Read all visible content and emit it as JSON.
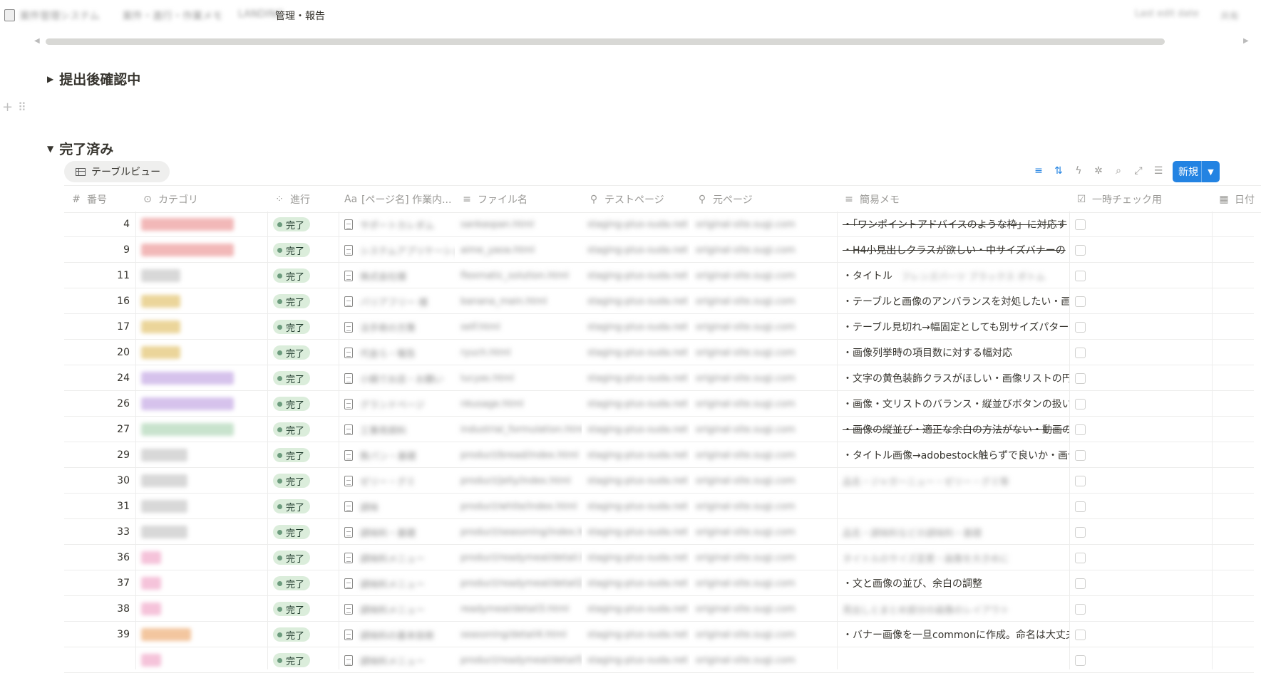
{
  "breadcrumb": {
    "blurred1": "案件管理システム",
    "blurred2": "案件・進行・作業メモ",
    "blurred3": "LANDING",
    "current": "管理・報告",
    "right1": "Last edit date",
    "right2": "共有"
  },
  "groups": {
    "submitted": {
      "title": "提出後確認中"
    },
    "done": {
      "title": "完了済み"
    }
  },
  "view": {
    "tab_label": "テーブルビュー"
  },
  "toolbar": {
    "new_label": "新規"
  },
  "columns": {
    "number": "番号",
    "category": "カテゴリ",
    "progress": "進行",
    "page_name": "[ページ名] 作業内...",
    "file_name": "ファイル名",
    "test_page": "テストページ",
    "original_page": "元ページ",
    "memo": "簡易メモ",
    "temp_check": "一時チェック用",
    "date": "日付"
  },
  "status_label": "完了",
  "colors": {
    "accent": "#2383e2",
    "status_bg": "#dbeddb",
    "status_dot": "#6c9b7d"
  },
  "rows": [
    {
      "num": "4",
      "cat_color": "#f2b8b8",
      "cat_w": 130,
      "page": "サポートカレダム",
      "file": "sankaspan.html",
      "test": "staging-plus-suda.net",
      "orig": "original-site.sugi.com",
      "memo": "・「ワンポイントアドバイスのような枠」に対応す",
      "memo_style": "strike"
    },
    {
      "num": "9",
      "cat_color": "#f2b8b8",
      "cat_w": 130,
      "page": "システムアプリケーション",
      "file": "aime_yaoa.html",
      "test": "staging-plus-suda.net",
      "orig": "original-site.sugi.com",
      "memo": "・H4小見出しクラスが欲しい・中サイズバナーの",
      "memo_style": "strike"
    },
    {
      "num": "11",
      "cat_color": "#d8d8d8",
      "cat_w": 55,
      "page": "株式会社様",
      "file": "flexmatic_solution.html",
      "test": "staging-plus-suda.net",
      "orig": "original-site.sugi.com",
      "memo": "・タイトル",
      "memo_style": "plain",
      "memo_extra": "フレンズパーツ ブラックス ボトム"
    },
    {
      "num": "16",
      "cat_color": "#ebd59a",
      "cat_w": 55,
      "page": "バリアフリー 様",
      "file": "banana_main.html",
      "test": "staging-plus-suda.net",
      "orig": "original-site.sugi.com",
      "memo": "・テーブルと画像のアンバランスを対処したい・画",
      "memo_style": "plain"
    },
    {
      "num": "17",
      "cat_color": "#ebd59a",
      "cat_w": 55,
      "page": "法手術の方策",
      "file": "self.html",
      "test": "staging-plus-suda.net",
      "orig": "original-site.sugi.com",
      "memo": "・テーブル見切れ→幅固定としても別サイズパター",
      "memo_style": "plain"
    },
    {
      "num": "20",
      "cat_color": "#ebd59a",
      "cat_w": 55,
      "page": "代金ら・報告",
      "file": "ryuch.html",
      "test": "staging-plus-suda.net",
      "orig": "original-site.sugi.com",
      "memo": "・画像列挙時の項目数に対する幅対応",
      "memo_style": "plain"
    },
    {
      "num": "24",
      "cat_color": "#d6c2ec",
      "cat_w": 130,
      "page": "小鍋でお店・お願い",
      "file": "lucyas.html",
      "test": "staging-plus-suda.net",
      "orig": "original-site.sugi.com",
      "memo": "・文字の黄色装飾クラスがほしい・画像リストの円",
      "memo_style": "plain"
    },
    {
      "num": "26",
      "cat_color": "#d6c2ec",
      "cat_w": 130,
      "page": "グランドページ",
      "file": "nkusage.html",
      "test": "staging-plus-suda.net",
      "orig": "original-site.sugi.com",
      "memo": "・画像・文リストのバランス・縦並びボタンの扱い",
      "memo_style": "plain"
    },
    {
      "num": "27",
      "cat_color": "#c8e3cd",
      "cat_w": 130,
      "page": "工事用資料",
      "file": "industrial_formulation.html",
      "test": "staging-plus-suda.net",
      "orig": "original-site.sugi.com",
      "memo": "・画像の縦並び・適正な余白の方法がない・動画の",
      "memo_style": "strike"
    },
    {
      "num": "29",
      "cat_color": "#d8d8d8",
      "cat_w": 65,
      "page": "数パン・基礎",
      "file": "product/bread/index.html",
      "test": "staging-plus-suda.net",
      "orig": "original-site.sugi.com",
      "memo": "・タイトル画像→adobestock触らずで良いか・画像",
      "memo_style": "plain"
    },
    {
      "num": "30",
      "cat_color": "#d8d8d8",
      "cat_w": 65,
      "page": "ゼリー・グミ",
      "file": "product/jelly/index.html",
      "test": "staging-plus-suda.net",
      "orig": "original-site.sugi.com",
      "memo": "",
      "memo_style": "blur",
      "memo_blur": "品名・ジャガーニュー・ゼリー・グミ等"
    },
    {
      "num": "31",
      "cat_color": "#d8d8d8",
      "cat_w": 65,
      "page": "調味",
      "file": "product/white/index.html",
      "test": "staging-plus-suda.net",
      "orig": "original-site.sugi.com",
      "memo": "",
      "memo_style": "none"
    },
    {
      "num": "33",
      "cat_color": "#d8d8d8",
      "cat_w": 65,
      "page": "調味料・基礎",
      "file": "product/seasoning/index.html",
      "test": "staging-plus-suda.net",
      "orig": "original-site.sugi.com",
      "memo": "",
      "memo_style": "blur",
      "memo_blur": "品名・調味料などの調味料・基礎"
    },
    {
      "num": "36",
      "cat_color": "#f5c3da",
      "cat_w": 28,
      "page": "調味料メニュー",
      "file": "product/readymeal/detail.html",
      "test": "staging-plus-suda.net",
      "orig": "original-site.sugi.com",
      "memo": "",
      "memo_style": "blur",
      "memo_blur": "タイトルのサイズ変更・画像を大きめに"
    },
    {
      "num": "37",
      "cat_color": "#f5c3da",
      "cat_w": 28,
      "page": "調味料メニュー",
      "file": "product/readymeal/detail2.html",
      "test": "staging-plus-suda.net",
      "orig": "original-site.sugi.com",
      "memo": "・文と画像の並び、余白の調整",
      "memo_style": "plain"
    },
    {
      "num": "38",
      "cat_color": "#f5c3da",
      "cat_w": 28,
      "page": "調味料メニュー",
      "file": "readymeal/detail3.html",
      "test": "staging-plus-suda.net",
      "orig": "original-site.sugi.com",
      "memo": "",
      "memo_style": "blur",
      "memo_blur": "見出しとまとめ部分の画像のレイアウト"
    },
    {
      "num": "39",
      "cat_color": "#f3c69f",
      "cat_w": 70,
      "page": "調味料の基本技術",
      "file": "seasoning/detail4.html",
      "test": "staging-plus-suda.net",
      "orig": "original-site.sugi.com",
      "memo": "・バナー画像を一旦commonに作成。命名は大丈夫",
      "memo_style": "plain"
    },
    {
      "num": "",
      "cat_color": "#f5c3da",
      "cat_w": 28,
      "page": "調味料メニュー",
      "file": "product/readymeal/detail5.html",
      "test": "staging-plus-suda.net",
      "orig": "original-site.sugi.com",
      "memo": "",
      "memo_style": "none"
    }
  ]
}
